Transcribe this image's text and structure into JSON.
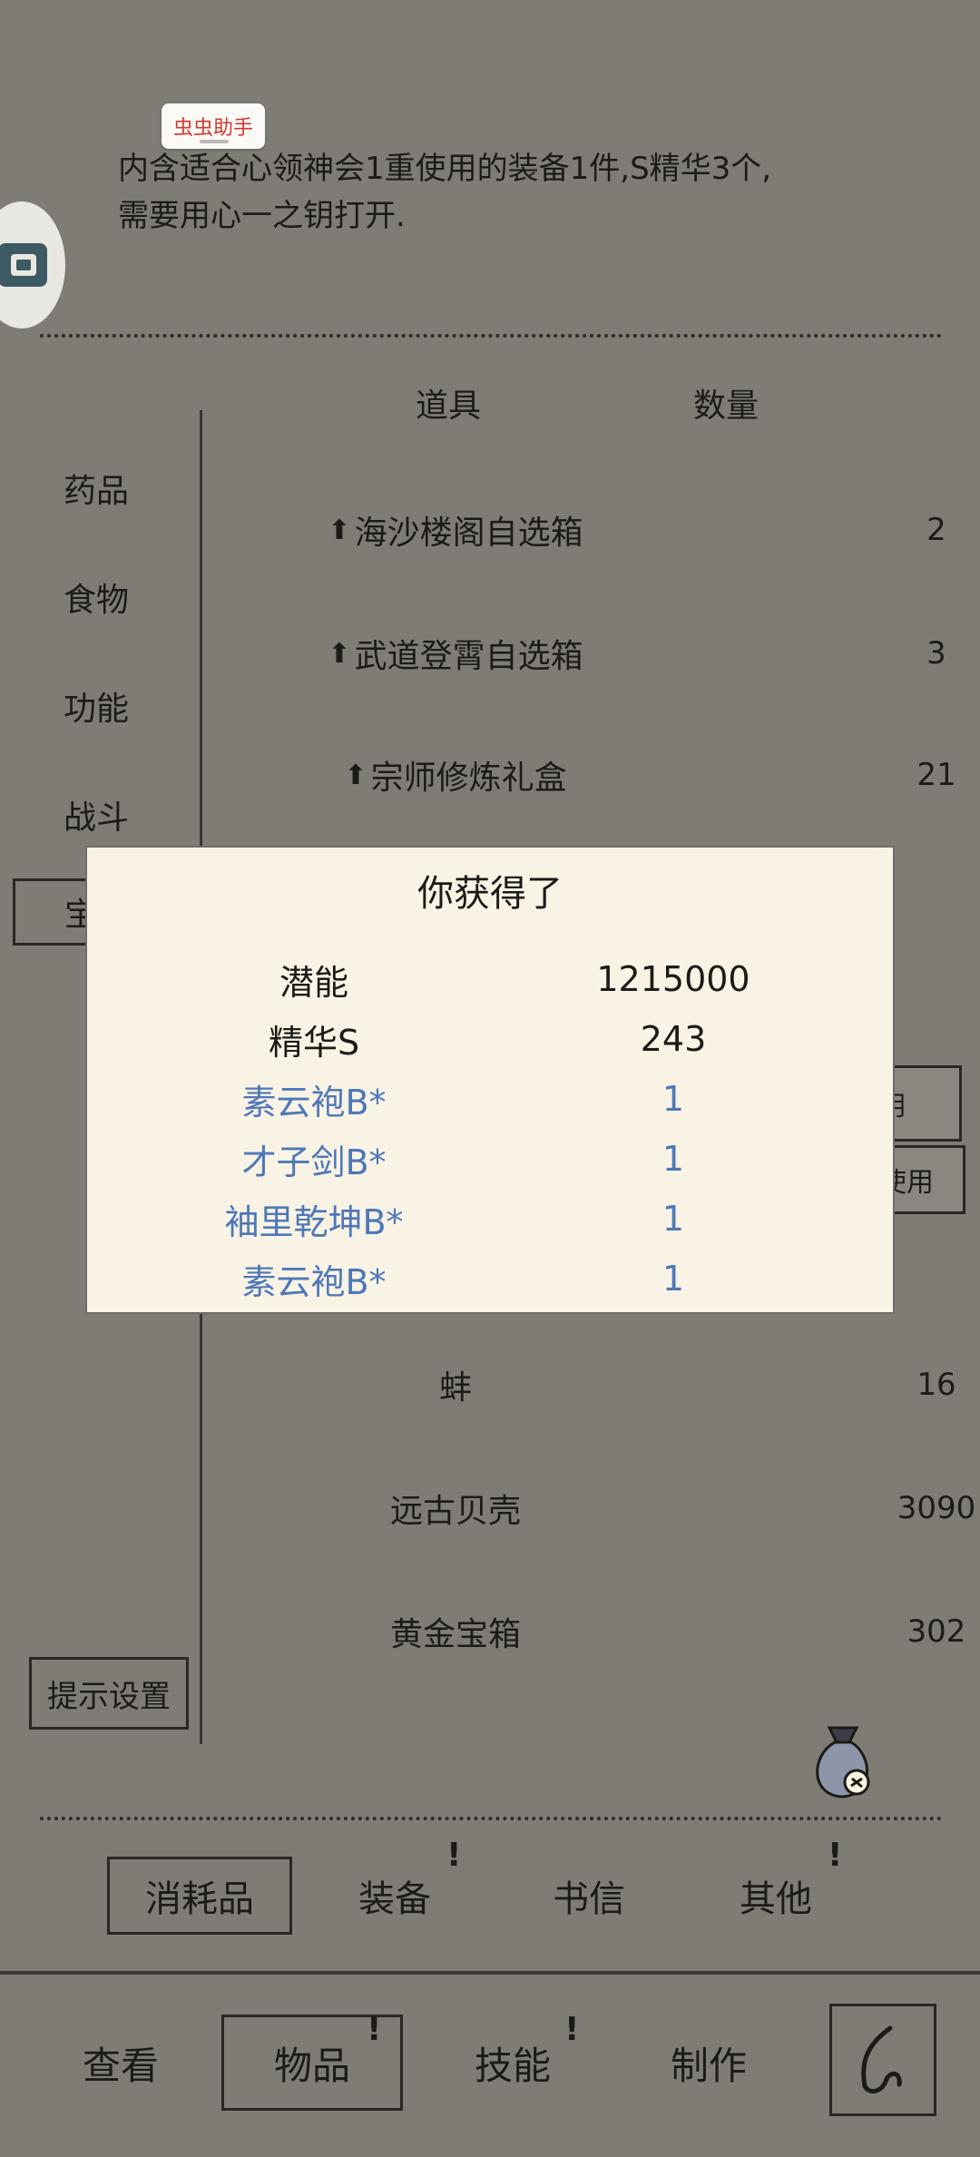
{
  "overlay": {
    "assistant_label": "虫虫助手"
  },
  "description": {
    "line1": "内含适合心领神会1重使用的装备1件,S精华3个,",
    "line2": "需要用心一之钥打开."
  },
  "table": {
    "col_item": "道具",
    "col_qty": "数量"
  },
  "categories": [
    {
      "label": "药品"
    },
    {
      "label": "食物"
    },
    {
      "label": "功能"
    },
    {
      "label": "战斗"
    },
    {
      "label": "宝"
    }
  ],
  "items_top": [
    {
      "name": "海沙楼阁自选箱",
      "qty": "2",
      "pinned": true
    },
    {
      "name": "武道登霄自选箱",
      "qty": "3",
      "pinned": true
    },
    {
      "name": "宗师修炼礼盒",
      "qty": "21",
      "pinned": true
    }
  ],
  "side_buttons": [
    {
      "label": "用"
    },
    {
      "label": "使用"
    }
  ],
  "items_bottom": [
    {
      "name": "蚌",
      "qty": "16"
    },
    {
      "name": "远古贝壳",
      "qty": "3090"
    },
    {
      "name": "黄金宝箱",
      "qty": "302"
    }
  ],
  "hint_button": "提示设置",
  "popup": {
    "title": "你获得了",
    "rows": [
      {
        "name": "潜能",
        "value": "1215000",
        "type": "resource"
      },
      {
        "name": "精华S",
        "value": "243",
        "type": "resource"
      },
      {
        "name": "素云袍B*",
        "value": "1",
        "type": "equipment"
      },
      {
        "name": "才子剑B*",
        "value": "1",
        "type": "equipment"
      },
      {
        "name": "袖里乾坤B*",
        "value": "1",
        "type": "equipment"
      },
      {
        "name": "素云袍B*",
        "value": "1",
        "type": "equipment"
      }
    ]
  },
  "sub_tabs": [
    {
      "label": "消耗品",
      "active": true,
      "alert": false
    },
    {
      "label": "装备",
      "active": false,
      "alert": true
    },
    {
      "label": "书信",
      "active": false,
      "alert": false
    },
    {
      "label": "其他",
      "active": false,
      "alert": true
    }
  ],
  "alert_mark": "!",
  "bottom_nav": [
    {
      "label": "查看",
      "active": false,
      "alert": false
    },
    {
      "label": "物品",
      "active": true,
      "alert": true
    },
    {
      "label": "技能",
      "active": false,
      "alert": true
    },
    {
      "label": "制作",
      "active": false,
      "alert": false
    }
  ],
  "icons": {
    "pin": "pin-up-icon",
    "bag": "money-bag-link-icon",
    "back": "back-curve-icon"
  },
  "colors": {
    "background": "#7f7c76",
    "popup": "#f8f3e5",
    "equipment_text": "#4f78b8",
    "assistant_text": "#d23a2e"
  }
}
